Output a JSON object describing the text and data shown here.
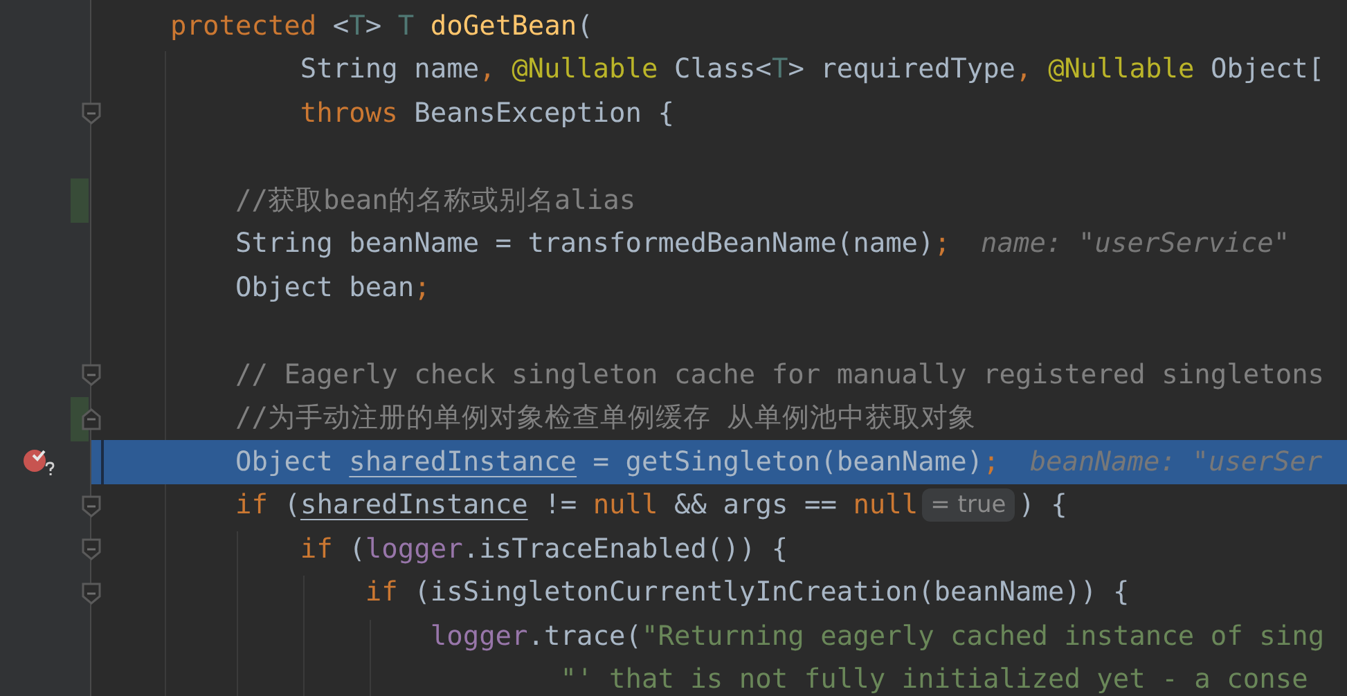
{
  "editor": {
    "lines": [
      {
        "current": false,
        "changed": false,
        "breakpoint": false,
        "tokens": [
          {
            "kind": "keyword",
            "text": "protected"
          },
          {
            "kind": "plain",
            "text": " <"
          },
          {
            "kind": "typeparam",
            "text": "T"
          },
          {
            "kind": "plain",
            "text": ">"
          },
          {
            "kind": "typeparam",
            "text": " T"
          },
          {
            "kind": "decl",
            "text": " doGetBean"
          },
          {
            "kind": "plain",
            "text": "("
          }
        ]
      },
      {
        "current": false,
        "changed": false,
        "breakpoint": false,
        "tokens": [
          {
            "kind": "plain",
            "text": "        String name"
          },
          {
            "kind": "keyword",
            "text": ","
          },
          {
            "kind": "annotation",
            "text": " @Nullable"
          },
          {
            "kind": "plain",
            "text": " Class<"
          },
          {
            "kind": "typeparam",
            "text": "T"
          },
          {
            "kind": "plain",
            "text": "> requiredType"
          },
          {
            "kind": "keyword",
            "text": ","
          },
          {
            "kind": "annotation",
            "text": " @Nullable"
          },
          {
            "kind": "plain",
            "text": " Object["
          }
        ]
      },
      {
        "current": false,
        "changed": false,
        "breakpoint": false,
        "fold_marker": {
          "kind": "start"
        },
        "tokens": [
          {
            "kind": "keyword",
            "text": "        throws"
          },
          {
            "kind": "plain",
            "text": " BeansException {"
          }
        ]
      },
      {
        "current": false,
        "changed": false,
        "breakpoint": false
      },
      {
        "current": false,
        "changed": true,
        "breakpoint": false,
        "tokens": [
          {
            "kind": "comment",
            "text": "    //获取bean的名称或别名alias"
          }
        ]
      },
      {
        "current": false,
        "changed": false,
        "breakpoint": false,
        "tokens": [
          {
            "kind": "plain",
            "text": "    String beanName = transformedBeanName(name)"
          },
          {
            "kind": "keyword",
            "text": ";"
          },
          {
            "kind": "hint",
            "text": "name: \"userService\""
          }
        ]
      },
      {
        "current": false,
        "changed": false,
        "breakpoint": false,
        "tokens": [
          {
            "kind": "plain",
            "text": "    Object bean"
          },
          {
            "kind": "keyword",
            "text": ";"
          }
        ]
      },
      {
        "current": false,
        "changed": false,
        "breakpoint": false
      },
      {
        "current": false,
        "changed": false,
        "breakpoint": false,
        "fold_marker": {
          "kind": "start"
        },
        "tokens": [
          {
            "kind": "comment",
            "text": "    // Eagerly check singleton cache for manually registered singletons"
          }
        ]
      },
      {
        "current": false,
        "changed": true,
        "breakpoint": false,
        "fold_marker": {
          "kind": "end"
        },
        "tokens": [
          {
            "kind": "comment",
            "text": "    //为手动注册的单例对象检查单例缓存 从单例池中获取对象"
          }
        ]
      },
      {
        "current": true,
        "changed": false,
        "breakpoint": true,
        "tokens": [
          {
            "kind": "plain",
            "text": "    Object"
          },
          {
            "kind": "underlined",
            "text": " sharedInstance"
          },
          {
            "kind": "plain",
            "text": " = getSingleton(beanName)"
          },
          {
            "kind": "keyword",
            "text": ";"
          },
          {
            "kind": "hint",
            "text": "beanName: \"userSer"
          }
        ]
      },
      {
        "current": false,
        "changed": false,
        "breakpoint": false,
        "fold_marker": {
          "kind": "start"
        },
        "tokens": [
          {
            "kind": "keyword",
            "text": "    if"
          },
          {
            "kind": "plain",
            "text": " ("
          },
          {
            "kind": "underlined",
            "text": "sharedInstance"
          },
          {
            "kind": "plain",
            "text": " !="
          },
          {
            "kind": "keyword",
            "text": " null"
          },
          {
            "kind": "plain",
            "text": " && args =="
          },
          {
            "kind": "keyword",
            "text": " null"
          },
          {
            "kind": "inlay",
            "text": "= true"
          },
          {
            "kind": "plain",
            "text": ") {"
          }
        ]
      },
      {
        "current": false,
        "changed": false,
        "breakpoint": false,
        "fold_marker": {
          "kind": "start"
        },
        "tokens": [
          {
            "kind": "keyword",
            "text": "        if"
          },
          {
            "kind": "plain",
            "text": " ("
          },
          {
            "kind": "field",
            "text": "logger"
          },
          {
            "kind": "plain",
            "text": ".isTraceEnabled()) {"
          }
        ]
      },
      {
        "current": false,
        "changed": false,
        "breakpoint": false,
        "fold_marker": {
          "kind": "start"
        },
        "tokens": [
          {
            "kind": "keyword",
            "text": "            if"
          },
          {
            "kind": "plain",
            "text": " (isSingletonCurrentlyInCreation(beanName)) {"
          }
        ]
      },
      {
        "current": false,
        "changed": false,
        "breakpoint": false,
        "tokens": [
          {
            "kind": "field",
            "text": "                logger"
          },
          {
            "kind": "plain",
            "text": ".trace("
          },
          {
            "kind": "string",
            "text": "\"Returning eagerly cached instance of sing"
          }
        ]
      },
      {
        "current": false,
        "changed": false,
        "breakpoint": false,
        "tokens": [
          {
            "kind": "string",
            "text": "                        \"' that is not fully initialized yet - a conse"
          }
        ]
      }
    ]
  }
}
